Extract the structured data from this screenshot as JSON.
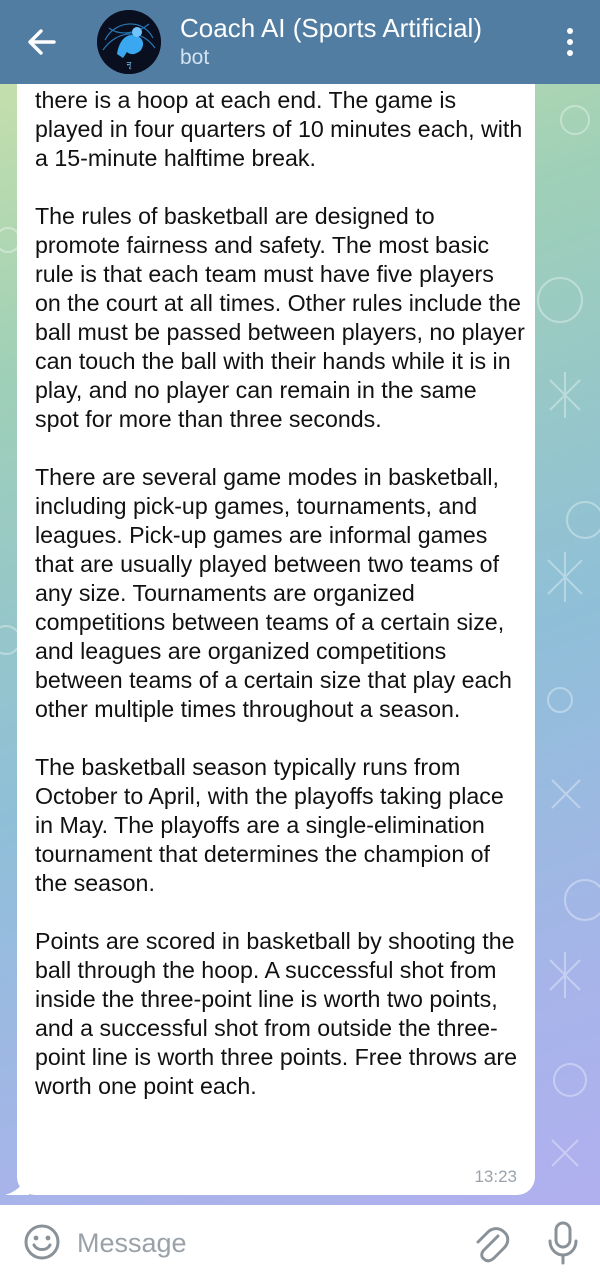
{
  "header": {
    "title": "Coach AI (Sports Artificial)",
    "subtitle": "bot",
    "back_icon": "arrow-back-icon",
    "menu_icon": "more-vertical-icon",
    "bg_color": "#517da2"
  },
  "message": {
    "paragraphs": [
      "there is a hoop at each end. The game is played in four quarters of 10 minutes each, with a 15-minute halftime break.",
      "The rules of basketball are designed to promote fairness and safety. The most basic rule is that each team must have five players on the court at all times. Other rules include the ball must be passed between players, no player can touch the ball with their hands while it is in play, and no player can remain in the same spot for more than three seconds.",
      "There are several game modes in basketball, including pick-up games, tournaments, and leagues. Pick-up games are informal games that are usually played between two teams of any size. Tournaments are organized competitions between teams of a certain size, and leagues are organized competitions between teams of a certain size that play each other multiple times throughout a season.",
      "The basketball season typically runs from October to April, with the playoffs taking place in May. The playoffs are a single-elimination tournament that determines the champion of the season.",
      "Points are scored in basketball by shooting the ball through the hoop. A successful shot from inside the three-point line is worth two points, and a successful shot from outside the three-point line is worth three points. Free throws are worth one point each."
    ],
    "time": "13:23"
  },
  "composer": {
    "placeholder": "Message",
    "value": "",
    "emoji_icon": "emoji-icon",
    "attach_icon": "paperclip-icon",
    "mic_icon": "microphone-icon"
  }
}
